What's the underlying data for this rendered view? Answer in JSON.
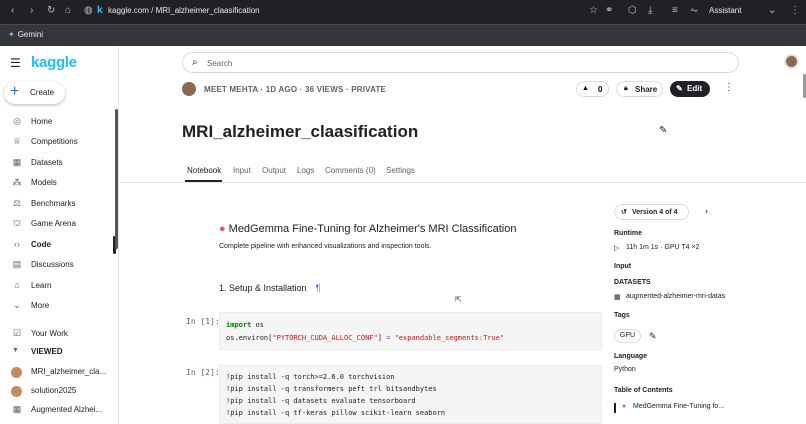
{
  "browser": {
    "url": "kaggle.com / MRI_alzheimer_claasification",
    "assistant_label": "Assistant",
    "bookmark": "Gemini"
  },
  "sidebar": {
    "logo": "kaggle",
    "create_label": "Create",
    "items": [
      {
        "label": "Home",
        "icon": "compass-icon"
      },
      {
        "label": "Competitions",
        "icon": "trophy-icon"
      },
      {
        "label": "Datasets",
        "icon": "table-icon"
      },
      {
        "label": "Models",
        "icon": "models-icon"
      },
      {
        "label": "Benchmarks",
        "icon": "benchmark-icon"
      },
      {
        "label": "Game Arena",
        "icon": "game-icon"
      },
      {
        "label": "Code",
        "icon": "code-icon"
      },
      {
        "label": "Discussions",
        "icon": "discussion-icon"
      },
      {
        "label": "Learn",
        "icon": "learn-icon"
      },
      {
        "label": "More",
        "icon": "chevron-down-icon"
      },
      {
        "label": "Your Work",
        "icon": "your-work-icon"
      }
    ],
    "viewed_heading": "VIEWED",
    "viewed": [
      "MRI_alzheimer_cla...",
      "solution2025",
      "Augmented Alzhei..."
    ]
  },
  "search": {
    "placeholder": "Search"
  },
  "notebook": {
    "meta": "MEET MEHTA · 1D AGO · 36 VIEWS · PRIVATE",
    "votes": "0",
    "share_label": "Share",
    "edit_label": "Edit",
    "title": "MRI_alzheimer_claasification",
    "tabs": [
      "Notebook",
      "Input",
      "Output",
      "Logs",
      "Comments (0)",
      "Settings"
    ],
    "heading": "MedGemma Fine-Tuning for Alzheimer's MRI Classification",
    "subtitle": "Complete pipeline with enhanced visualizations and inspection tools.",
    "section": "1. Setup & Installation",
    "pilcrow": "¶",
    "cell1": {
      "prompt": "In [1]:",
      "line1_kw": "import",
      "line1_rest": " os",
      "line2_pre": "os.environ[",
      "line2_key": "\"PYTORCH_CUDA_ALLOC_CONF\"",
      "line2_mid": "] ",
      "line2_eq": "=",
      "line2_val": " \"expandable_segments:True\""
    },
    "cell2": {
      "prompt": "In [2]:",
      "lines": [
        "!pip install -q torch>=2.6.0 torchvision",
        "!pip install -q transformers peft trl bitsandbytes",
        "!pip install -q datasets evaluate tensorboard",
        "!pip install -q tf-keras pillow scikit-learn seaborn"
      ]
    }
  },
  "panel": {
    "version_label": "Version 4 of 4",
    "runtime_h": "Runtime",
    "runtime": "11h 1m 1s · GPU T4 ×2",
    "input_h": "Input",
    "datasets_h": "DATASETS",
    "dataset": "augmented-alzheimer-mri-datas",
    "tags_h": "Tags",
    "tag": "GPU",
    "language_h": "Language",
    "language": "Python",
    "toc_h": "Table of Contents",
    "toc_item": "MedGemma Fine-Tuning fo..."
  }
}
